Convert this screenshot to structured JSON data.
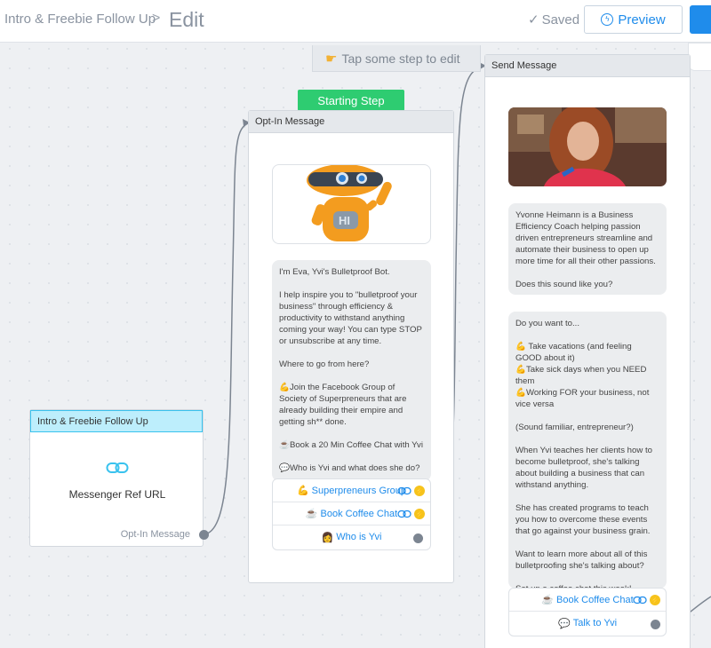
{
  "header": {
    "breadcrumb": "Intro & Freebie Follow Up",
    "separator": ">",
    "title": "Edit",
    "saved": "Saved",
    "preview": "Preview"
  },
  "hint": "Tap some step to edit",
  "start_badge": "Starting Step",
  "intro_card": {
    "title": "Intro & Freebie Follow Up",
    "ref_label": "Messenger Ref URL",
    "output_label": "Opt-In Message"
  },
  "optin_card": {
    "title": "Opt-In Message",
    "robot_sign": "HI",
    "message": "I'm Eva, Yvi's Bulletproof Bot.\n\nI help inspire you to \"bulletproof your business\" through efficiency & productivity to withstand anything coming your way! You can type STOP or unsubscribe at any time.\n\nWhere to go from here?\n\n💪Join the Facebook Group of Society of Superpreneurs that are already building their empire and getting sh** done.\n\n☕Book a 20 Min Coffee Chat with Yvi\n\n💬Who is Yvi and what does she do?",
    "buttons": [
      {
        "icon": "💪",
        "label": "Superpreneurs Group"
      },
      {
        "icon": "☕",
        "label": "Book Coffee Chat"
      },
      {
        "icon": "👩",
        "label": "Who is Yvi"
      }
    ]
  },
  "send_card": {
    "title": "Send Message",
    "bubble1": "Yvonne Heimann is a Business Efficiency Coach helping passion driven entrepreneurs streamline and automate their business to open up more time for all their other passions.\n\nDoes this sound like you?",
    "bubble2": "Do you want to...\n\n💪 Take vacations (and feeling GOOD about it)\n💪Take sick days when you NEED them\n💪Working FOR your business, not vice versa\n\n(Sound familiar, entrepreneur?)\n\nWhen Yvi teaches her clients how to become bulletproof, she's talking about building a business that can withstand anything.\n\nShe has created programs to teach you how to overcome these events that go against your business grain.\n\nWant to learn more about all of this bulletproofing she's talking about?\n\nSet up a coffee chat this week!",
    "buttons": [
      {
        "icon": "☕",
        "label": "Book Coffee Chat"
      },
      {
        "icon": "💬",
        "label": "Talk to Yvi"
      }
    ]
  },
  "colors": {
    "accent": "#1f8ceb",
    "start_green": "#2ecc71",
    "entry_highlight": "#39c2ee",
    "bolt": "#f6c31c"
  },
  "icons": [
    "check-icon",
    "messenger-icon",
    "pointing-hand-icon",
    "link-icon",
    "bolt-icon"
  ]
}
